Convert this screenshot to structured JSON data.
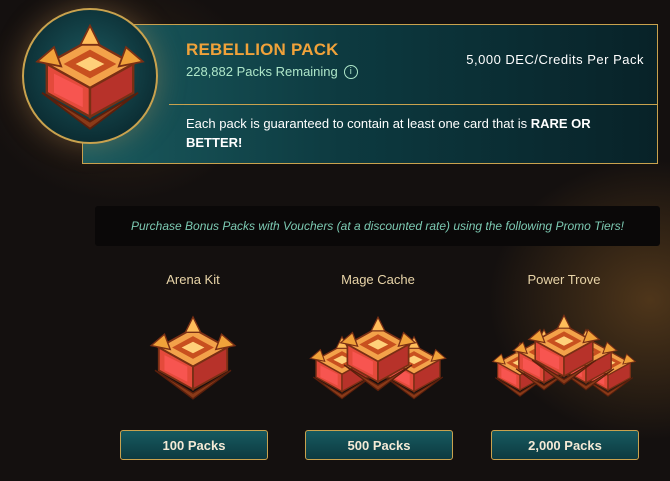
{
  "pack": {
    "title": "REBELLION PACK",
    "remaining": "228,882 Packs Remaining",
    "price": "5,000 DEC/Credits Per Pack",
    "guarantee_prefix": "Each pack is guaranteed to contain at least one card that is ",
    "guarantee_emphasis": "RARE OR BETTER!"
  },
  "promo": {
    "text": "Purchase Bonus Packs with Vouchers (at a discounted rate) using the following Promo Tiers!"
  },
  "tiers": [
    {
      "name": "Arena Kit",
      "button": "100 Packs"
    },
    {
      "name": "Mage Cache",
      "button": "500 Packs"
    },
    {
      "name": "Power Trove",
      "button": "2,000 Packs"
    }
  ],
  "colors": {
    "accent_gold": "#c9a24e",
    "title_orange": "#f0a23a",
    "teal_panel": "#1a5a5e",
    "promo_text": "#7cc9b2"
  },
  "icons": {
    "info": "info-icon",
    "pack": "rebellion-pack-icon"
  }
}
